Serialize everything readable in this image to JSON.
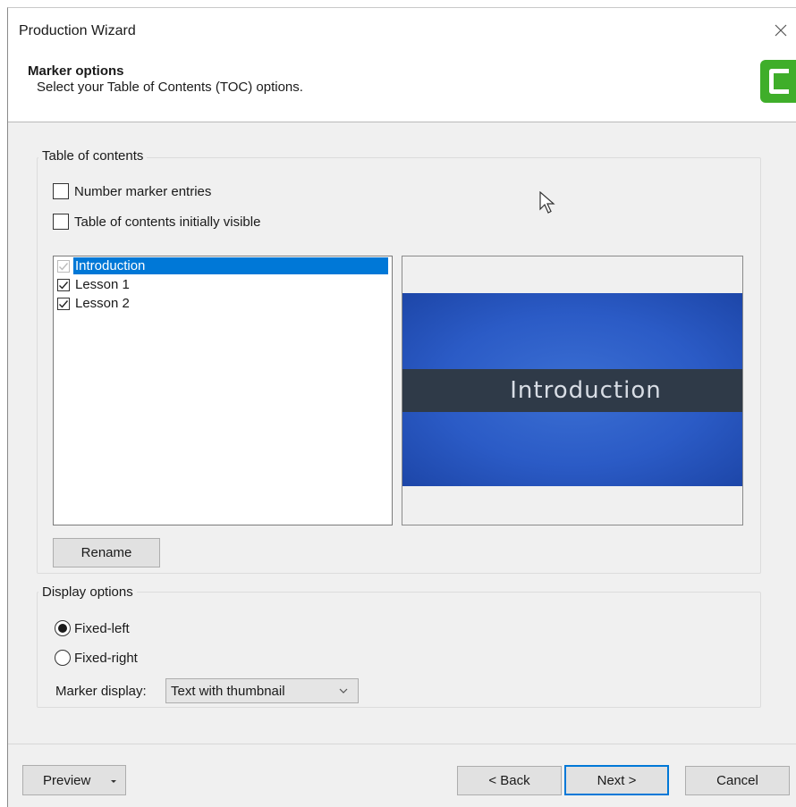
{
  "window": {
    "title": "Production Wizard"
  },
  "header": {
    "title": "Marker options",
    "subtitle": "Select your Table of Contents (TOC) options."
  },
  "toc_group": {
    "label": "Table of contents",
    "number_entries": {
      "label": "Number marker entries",
      "checked": false
    },
    "initially_visible": {
      "label": "Table of contents initially visible",
      "checked": false
    }
  },
  "marker_list": [
    {
      "label": "Introduction",
      "checked": true,
      "selected": true,
      "disabled": true
    },
    {
      "label": "Lesson 1",
      "checked": true,
      "selected": false
    },
    {
      "label": "Lesson 2",
      "checked": true,
      "selected": false
    }
  ],
  "preview": {
    "slide_text": "Introduction"
  },
  "rename_button": "Rename",
  "display_group": {
    "label": "Display options",
    "fixed_left": {
      "label": "Fixed-left",
      "selected": true
    },
    "fixed_right": {
      "label": "Fixed-right",
      "selected": false
    },
    "marker_display_label": "Marker display:",
    "marker_display_value": "Text with thumbnail"
  },
  "footer": {
    "preview_label": "Preview",
    "back_label": "< Back",
    "next_label": "Next >",
    "cancel_label": "Cancel"
  },
  "colors": {
    "selection": "#0078d7",
    "slide_blue": "#2b5bc6",
    "slide_band": "#2f3a48",
    "logo_green": "#3fae2a"
  }
}
